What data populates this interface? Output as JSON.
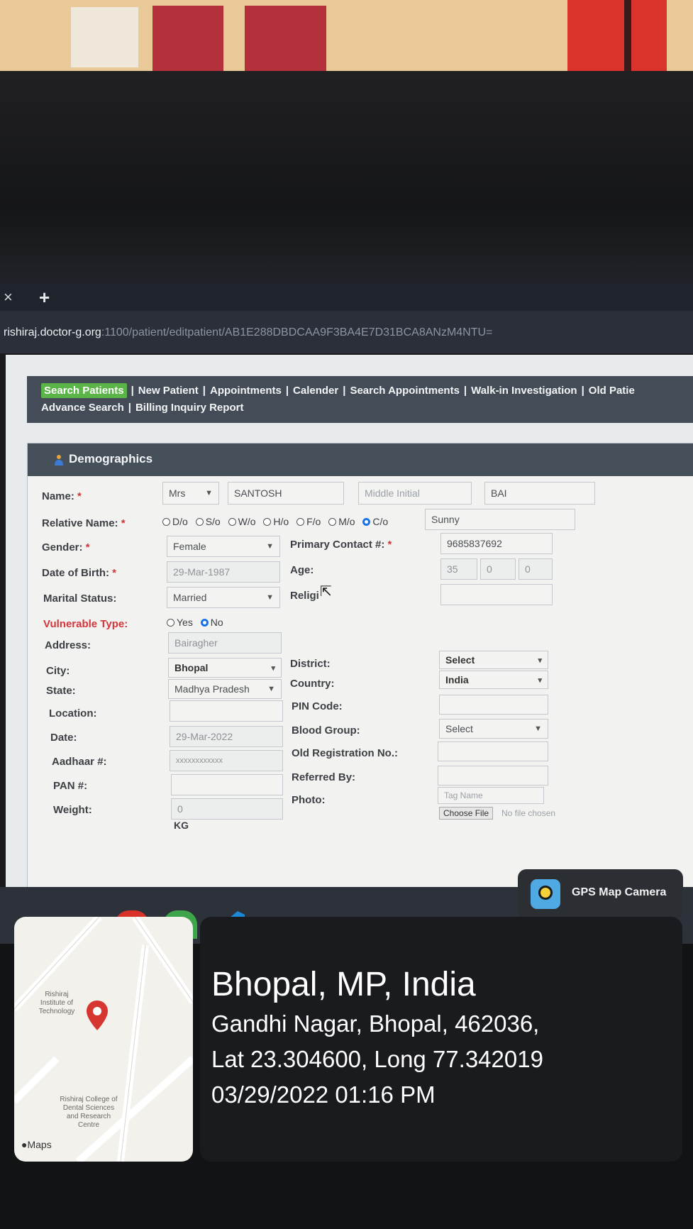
{
  "browser": {
    "tab_close_icon": "×",
    "new_tab_icon": "+",
    "url_host": "rishiraj.doctor-g.org",
    "url_rest": ":1100/patient/editpatient/AB1E288DBDCAA9F3BA4E7D31BCA8ANzM4NTU="
  },
  "nav": {
    "row1": [
      "Search Patients",
      "New Patient",
      "Appointments",
      "Calender",
      "Search Appointments",
      "Walk-in Investigation",
      "Old Patie"
    ],
    "row2": [
      "Advance Search",
      "Billing Inquiry Report"
    ]
  },
  "demographics": {
    "title": "Demographics",
    "name_label": "Name:",
    "title_select": "Mrs",
    "first_name": "SANTOSH",
    "middle_placeholder": "Middle Initial",
    "last_name": "BAI",
    "relative_label": "Relative Name:",
    "relative_options": [
      "D/o",
      "S/o",
      "W/o",
      "H/o",
      "F/o",
      "M/o",
      "C/o"
    ],
    "relative_selected": "C/o",
    "relative_name": "Sunny",
    "gender_label": "Gender:",
    "gender": "Female",
    "contact_label": "Primary Contact #:",
    "contact": "9685837692",
    "dob_label": "Date of Birth:",
    "dob": "29-Mar-1987",
    "age_label": "Age:",
    "age_years": "35",
    "age_months": "0",
    "age_days": "0",
    "marital_label": "Marital Status:",
    "marital": "Married",
    "religion_label": "Religi",
    "vulnerable_label": "Vulnerable Type:",
    "vulnerable_yes": "Yes",
    "vulnerable_no": "No",
    "address_label": "Address:",
    "address": "Bairagher",
    "city_label": "City:",
    "city": "Bhopal",
    "district_label": "District:",
    "district": "Select",
    "state_label": "State:",
    "state": "Madhya Pradesh",
    "country_label": "Country:",
    "country": "India",
    "location_label": "Location:",
    "pin_label": "PIN Code:",
    "date_label": "Date:",
    "date": "29-Mar-2022",
    "blood_label": "Blood Group:",
    "blood": "Select",
    "aadhaar_label": "Aadhaar #:",
    "aadhaar": "xxxxxxxxxxxx",
    "old_reg_label": "Old Registration No.:",
    "pan_label": "PAN #:",
    "referred_label": "Referred By:",
    "weight_label": "Weight:",
    "weight": "0",
    "weight_unit": "KG",
    "photo_label": "Photo:",
    "tag_placeholder": "Tag Name",
    "choose_file": "Choose File",
    "no_file": "No file chosen"
  },
  "overlay": {
    "app_name": "GPS Map Camera",
    "place": "Bhopal, MP, India",
    "address": "Gandhi Nagar, Bhopal, 462036,",
    "coords": "Lat 23.304600, Long 77.342019",
    "datetime": "03/29/2022 01:16 PM",
    "map_poi_1": "Rishiraj Institute of Technology",
    "map_poi_2": "Rishiraj College of Dental Sciences and Research Centre",
    "maps_brand": "Maps"
  },
  "colors": {
    "nav_active": "#5ab448",
    "required": "#d2353a",
    "radio_selected": "#1a73e8",
    "map_pin": "#d6362f"
  }
}
